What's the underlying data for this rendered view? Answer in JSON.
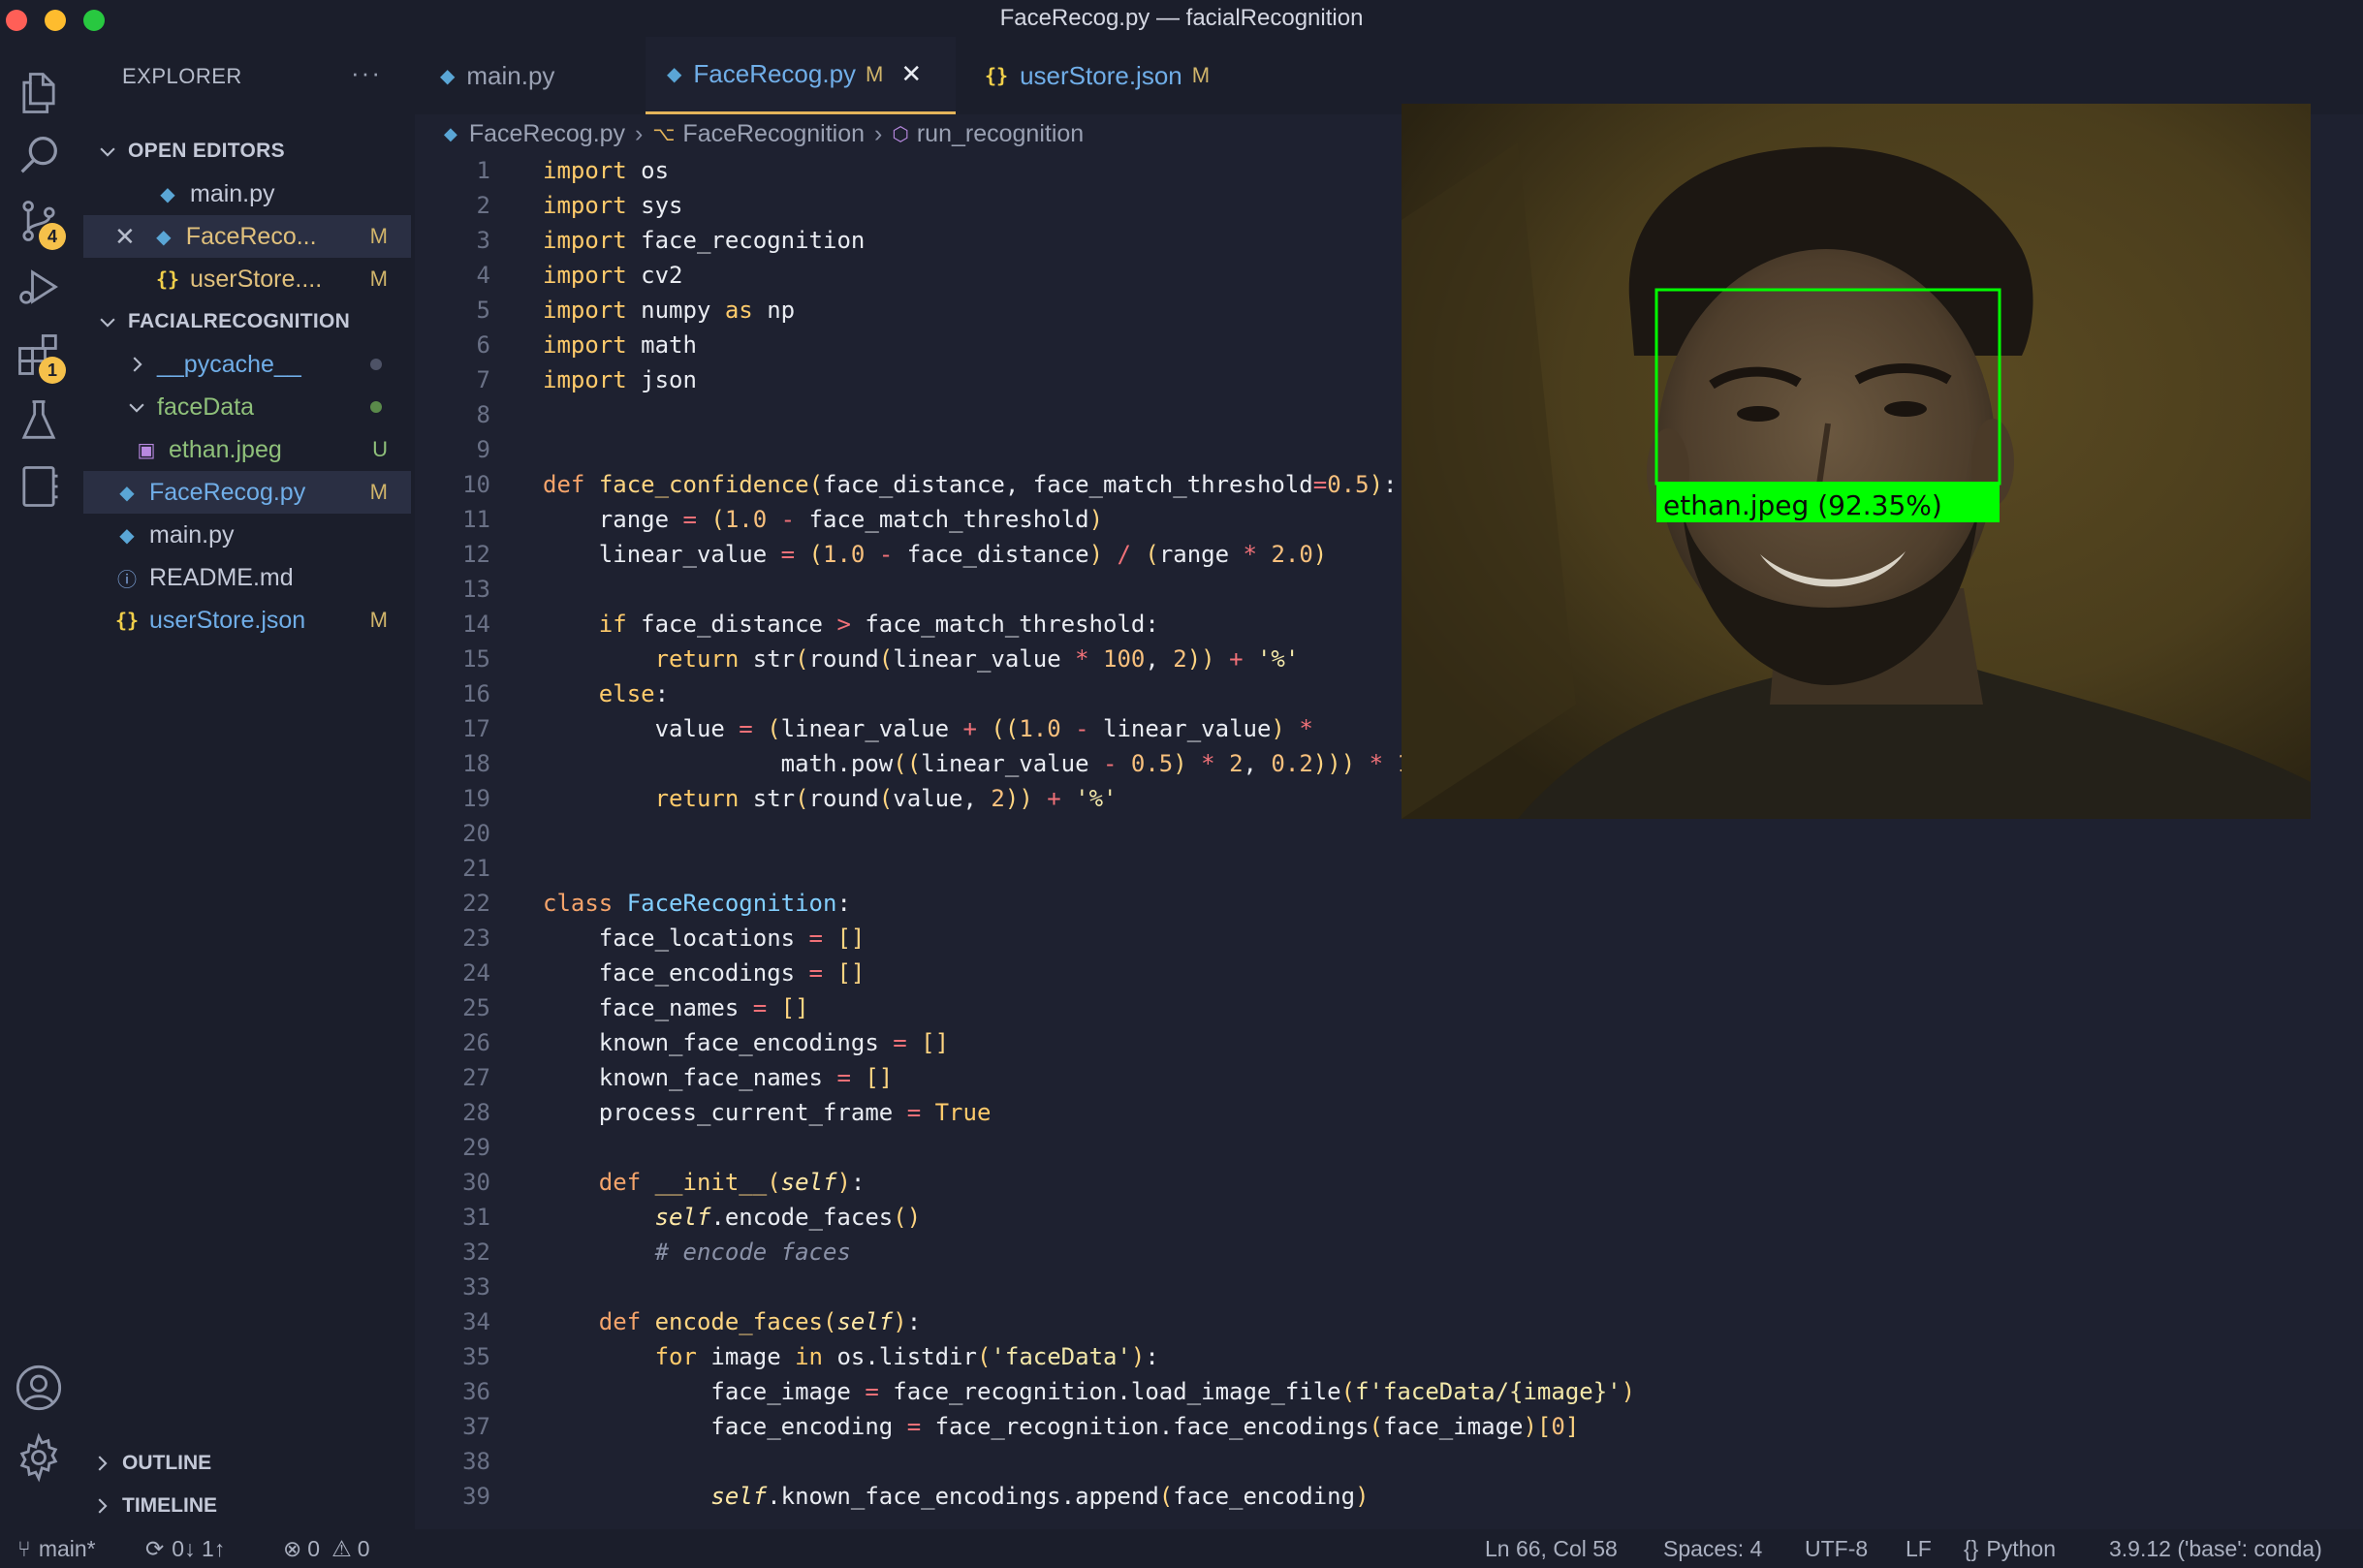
{
  "window": {
    "title": "FaceRecog.py — facialRecognition"
  },
  "activity": {
    "scm_badge": "4",
    "extensions_badge": "1"
  },
  "sidebar": {
    "header": "EXPLORER",
    "more": "···",
    "open_editors_label": "OPEN EDITORS",
    "open_editors": [
      {
        "name": "main.py",
        "status": ""
      },
      {
        "name": "FaceReco...",
        "status": "M"
      },
      {
        "name": "userStore....",
        "status": "M"
      }
    ],
    "project_label": "FACIALRECOGNITION",
    "tree": [
      {
        "name": "__pycache__",
        "type": "folder"
      },
      {
        "name": "faceData",
        "type": "folder"
      },
      {
        "name": "ethan.jpeg",
        "status": "U"
      },
      {
        "name": "FaceRecog.py",
        "status": "M"
      },
      {
        "name": "main.py",
        "status": ""
      },
      {
        "name": "README.md",
        "status": ""
      },
      {
        "name": "userStore.json",
        "status": "M"
      }
    ],
    "outline_label": "OUTLINE",
    "timeline_label": "TIMELINE"
  },
  "tabs": [
    {
      "label": "main.py",
      "status": ""
    },
    {
      "label": "FaceRecog.py",
      "status": "M"
    },
    {
      "label": "userStore.json",
      "status": "M"
    }
  ],
  "breadcrumb": [
    "FaceRecog.py",
    "FaceRecognition",
    "run_recognition"
  ],
  "camera": {
    "label": "ethan.jpeg (92.35%)"
  },
  "code_line_numbers": [
    "1",
    "2",
    "3",
    "4",
    "5",
    "6",
    "7",
    "8",
    "9",
    "10",
    "11",
    "12",
    "13",
    "14",
    "15",
    "16",
    "17",
    "18",
    "19",
    "20",
    "21",
    "22",
    "23",
    "24",
    "25",
    "26",
    "27",
    "28",
    "29",
    "30",
    "31",
    "32",
    "33",
    "34",
    "35",
    "36",
    "37",
    "38",
    "39"
  ],
  "code": [
    "import os",
    "import sys",
    "import face_recognition",
    "import cv2",
    "import numpy as np",
    "import math",
    "import json",
    "",
    "",
    "def face_confidence(face_distance, face_match_threshold=0.5):",
    "    range = (1.0 - face_match_threshold)",
    "    linear_value = (1.0 - face_distance) / (range * 2.0)",
    "",
    "    if face_distance > face_match_threshold:",
    "        return str(round(linear_value * 100, 2)) + '%'",
    "    else:",
    "        value = (linear_value + ((1.0 - linear_value) *",
    "                 math.pow((linear_value - 0.5) * 2, 0.2))) * 1",
    "        return str(round(value, 2)) + '%'",
    "",
    "",
    "class FaceRecognition:",
    "    face_locations = []",
    "    face_encodings = []",
    "    face_names = []",
    "    known_face_encodings = []",
    "    known_face_names = []",
    "    process_current_frame = True",
    "",
    "    def __init__(self):",
    "        self.encode_faces()",
    "        # encode faces",
    "",
    "    def encode_faces(self):",
    "        for image in os.listdir('faceData'):",
    "            face_image = face_recognition.load_image_file(f'faceData/{image}')",
    "            face_encoding = face_recognition.face_encodings(face_image)[0]",
    "",
    "            self.known_face_encodings.append(face_encoding)"
  ],
  "status": {
    "branch": "main*",
    "sync": "0↓ 1↑",
    "errors": "0",
    "warnings": "0",
    "position": "Ln 66, Col 58",
    "spaces": "Spaces: 4",
    "encoding": "UTF-8",
    "eol": "LF",
    "language": "Python",
    "interpreter": "3.9.12 ('base': conda)"
  }
}
